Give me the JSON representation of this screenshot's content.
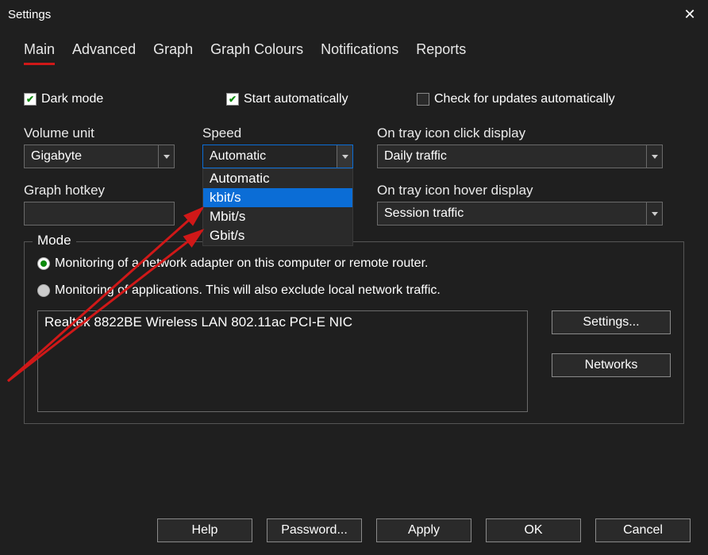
{
  "window": {
    "title": "Settings"
  },
  "tabs": [
    "Main",
    "Advanced",
    "Graph",
    "Graph Colours",
    "Notifications",
    "Reports"
  ],
  "checkboxes": {
    "dark_mode": {
      "label": "Dark mode",
      "checked": true
    },
    "start_auto": {
      "label": "Start automatically",
      "checked": true
    },
    "check_updates": {
      "label": "Check for updates automatically",
      "checked": false
    }
  },
  "fields": {
    "volume_unit": {
      "label": "Volume unit",
      "value": "Gigabyte"
    },
    "speed": {
      "label": "Speed",
      "value": "Automatic",
      "options": [
        "Automatic",
        "kbit/s",
        "Mbit/s",
        "Gbit/s"
      ],
      "highlighted": "kbit/s"
    },
    "tray_click": {
      "label": "On tray icon click display",
      "value": "Daily traffic"
    },
    "graph_hotkey": {
      "label": "Graph hotkey",
      "value": ""
    },
    "tray_hover": {
      "label": "On tray icon hover display",
      "value": "Session traffic"
    }
  },
  "mode": {
    "legend": "Mode",
    "opt_adapter": "Monitoring of a network adapter on this computer or remote router.",
    "opt_apps": "Monitoring of applications. This will also exclude local network traffic.",
    "selected": "adapter",
    "adapter": "Realtek 8822BE Wireless LAN 802.11ac PCI-E NIC",
    "btn_settings": "Settings...",
    "btn_networks": "Networks"
  },
  "buttons": {
    "help": "Help",
    "password": "Password...",
    "apply": "Apply",
    "ok": "OK",
    "cancel": "Cancel"
  }
}
